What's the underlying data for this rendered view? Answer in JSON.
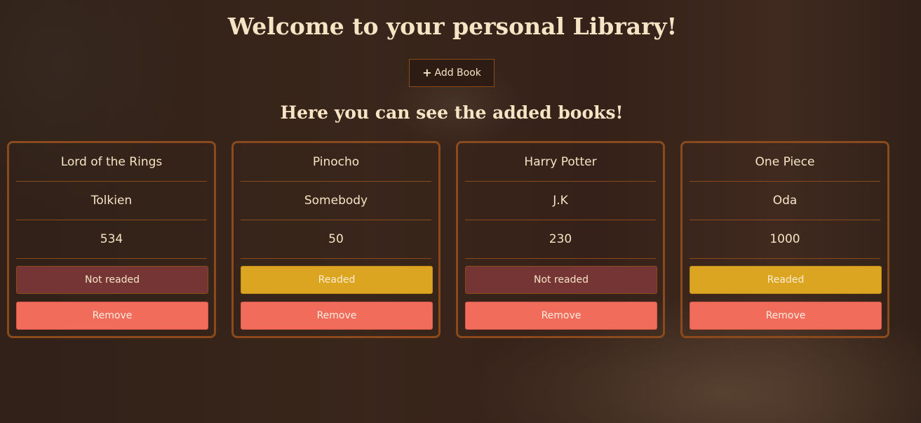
{
  "header": {
    "title": "Welcome to your personal Library!",
    "add_button_icon": "plus-icon",
    "add_button_label": "Add Book",
    "subtitle": "Here you can see the added books!"
  },
  "books": [
    {
      "title": "Lord of the Rings",
      "author": "Tolkien",
      "pages": "534",
      "status": "Not readed",
      "remove_label": "Remove"
    },
    {
      "title": "Pinocho",
      "author": "Somebody",
      "pages": "50",
      "status": "Readed",
      "remove_label": "Remove"
    },
    {
      "title": "Harry Potter",
      "author": "J.K",
      "pages": "230",
      "status": "Not readed",
      "remove_label": "Remove"
    },
    {
      "title": "One Piece",
      "author": "Oda",
      "pages": "1000",
      "status": "Readed",
      "remove_label": "Remove"
    }
  ],
  "colors": {
    "card_border": "#8a4a1c",
    "not_read": "#753535",
    "read": "#dba521",
    "remove": "#f26c5c",
    "text": "#f6e4c4"
  }
}
